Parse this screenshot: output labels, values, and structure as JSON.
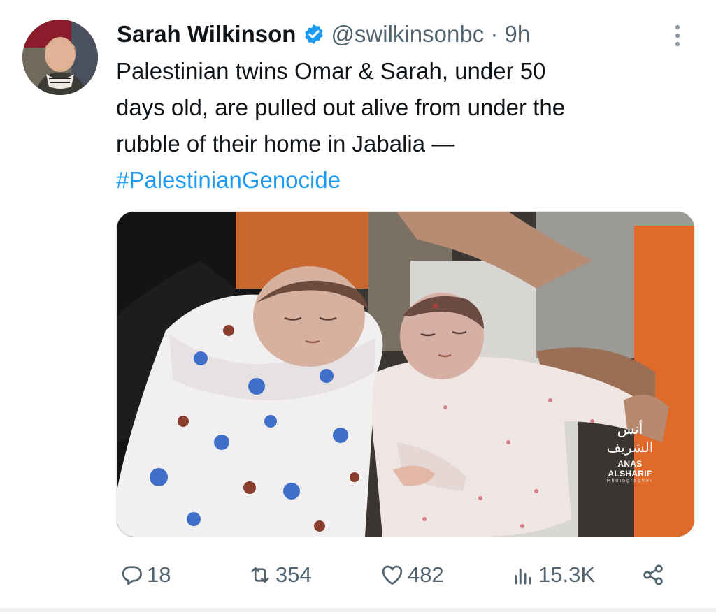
{
  "tweet": {
    "author_name": "Sarah Wilkinson",
    "handle_time": "@swilkinsonbc · 9h",
    "text": "Palestinian twins Omar & Sarah, under 50\ndays old, are pulled out alive from under the\nrubble of their home in Jabalia —",
    "hashtag": "#PalestinianGenocide",
    "verified_color": "#1d9bf0",
    "media": {
      "watermark_arabic": "أنس الشريف",
      "watermark_name": "ANAS ALSHARIF",
      "watermark_sub": "Photographer"
    }
  },
  "actions": {
    "replies": "18",
    "reposts": "354",
    "likes": "482",
    "views": "15.3K"
  },
  "icons": {
    "reply": "reply-icon",
    "repost": "repost-icon",
    "like": "like-icon",
    "views": "views-icon",
    "share": "share-icon",
    "more": "more-icon",
    "verified": "verified-badge-icon"
  }
}
